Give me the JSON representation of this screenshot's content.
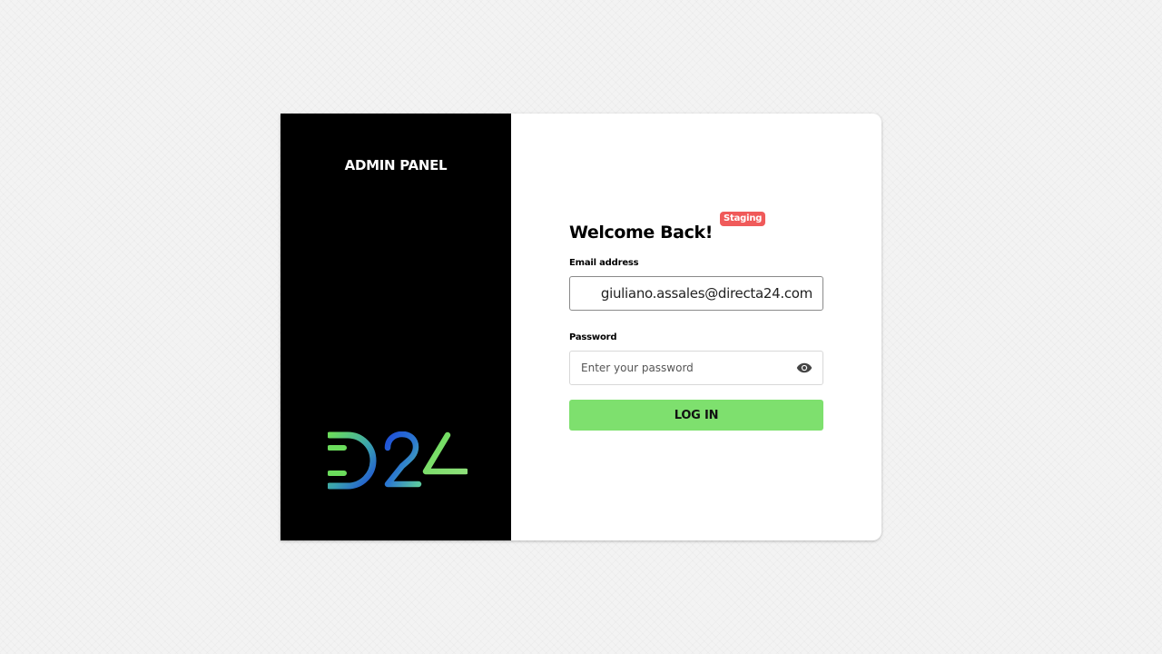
{
  "brand": {
    "panel_title": "ADMIN PANEL",
    "logo_text": "D24",
    "colors": {
      "accent_green": "#7ee06e",
      "badge_red": "#f05a5a",
      "logo_blue": "#1f4fd8",
      "logo_green": "#6bdc5c"
    }
  },
  "login_form": {
    "heading": "Welcome Back!",
    "environment_badge": "Staging",
    "email": {
      "label": "Email address",
      "value": "giuliano.assales@directa24.com"
    },
    "password": {
      "label": "Password",
      "placeholder": "Enter your password",
      "toggle_icon": "eye-icon"
    },
    "submit_label": "LOG IN"
  }
}
